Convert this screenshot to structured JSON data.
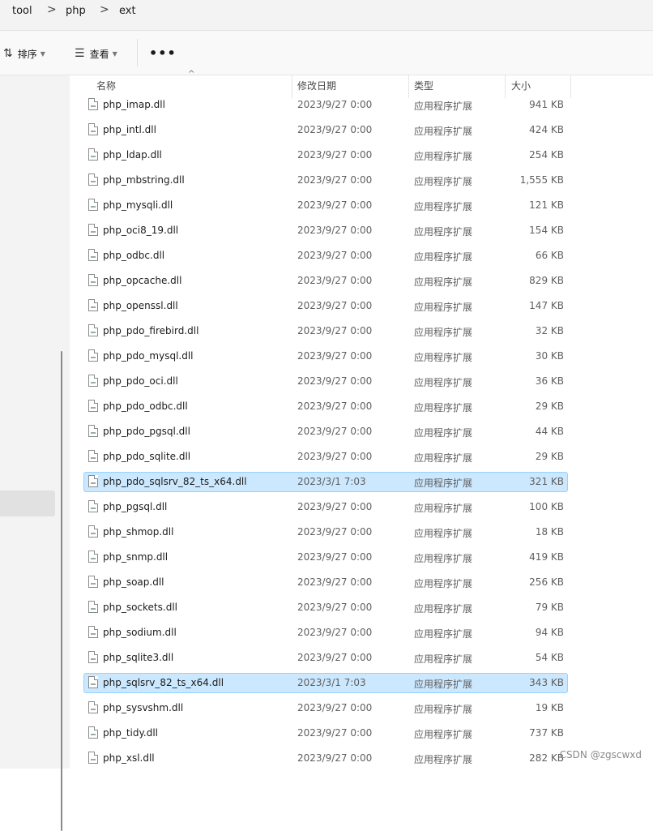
{
  "breadcrumb": {
    "items": [
      "tool",
      "php",
      "ext"
    ],
    "separator": ">"
  },
  "toolbar": {
    "sort_label": "排序",
    "view_label": "查看",
    "more_label": "•••"
  },
  "columns": {
    "name": "名称",
    "modified": "修改日期",
    "type": "类型",
    "size": "大小"
  },
  "files": [
    {
      "name": "php_imap.dll",
      "modified": "2023/9/27 0:00",
      "type": "应用程序扩展",
      "size": "941 KB",
      "selected": false
    },
    {
      "name": "php_intl.dll",
      "modified": "2023/9/27 0:00",
      "type": "应用程序扩展",
      "size": "424 KB",
      "selected": false
    },
    {
      "name": "php_ldap.dll",
      "modified": "2023/9/27 0:00",
      "type": "应用程序扩展",
      "size": "254 KB",
      "selected": false
    },
    {
      "name": "php_mbstring.dll",
      "modified": "2023/9/27 0:00",
      "type": "应用程序扩展",
      "size": "1,555 KB",
      "selected": false
    },
    {
      "name": "php_mysqli.dll",
      "modified": "2023/9/27 0:00",
      "type": "应用程序扩展",
      "size": "121 KB",
      "selected": false
    },
    {
      "name": "php_oci8_19.dll",
      "modified": "2023/9/27 0:00",
      "type": "应用程序扩展",
      "size": "154 KB",
      "selected": false
    },
    {
      "name": "php_odbc.dll",
      "modified": "2023/9/27 0:00",
      "type": "应用程序扩展",
      "size": "66 KB",
      "selected": false
    },
    {
      "name": "php_opcache.dll",
      "modified": "2023/9/27 0:00",
      "type": "应用程序扩展",
      "size": "829 KB",
      "selected": false
    },
    {
      "name": "php_openssl.dll",
      "modified": "2023/9/27 0:00",
      "type": "应用程序扩展",
      "size": "147 KB",
      "selected": false
    },
    {
      "name": "php_pdo_firebird.dll",
      "modified": "2023/9/27 0:00",
      "type": "应用程序扩展",
      "size": "32 KB",
      "selected": false
    },
    {
      "name": "php_pdo_mysql.dll",
      "modified": "2023/9/27 0:00",
      "type": "应用程序扩展",
      "size": "30 KB",
      "selected": false
    },
    {
      "name": "php_pdo_oci.dll",
      "modified": "2023/9/27 0:00",
      "type": "应用程序扩展",
      "size": "36 KB",
      "selected": false
    },
    {
      "name": "php_pdo_odbc.dll",
      "modified": "2023/9/27 0:00",
      "type": "应用程序扩展",
      "size": "29 KB",
      "selected": false
    },
    {
      "name": "php_pdo_pgsql.dll",
      "modified": "2023/9/27 0:00",
      "type": "应用程序扩展",
      "size": "44 KB",
      "selected": false
    },
    {
      "name": "php_pdo_sqlite.dll",
      "modified": "2023/9/27 0:00",
      "type": "应用程序扩展",
      "size": "29 KB",
      "selected": false
    },
    {
      "name": "php_pdo_sqlsrv_82_ts_x64.dll",
      "modified": "2023/3/1 7:03",
      "type": "应用程序扩展",
      "size": "321 KB",
      "selected": true
    },
    {
      "name": "php_pgsql.dll",
      "modified": "2023/9/27 0:00",
      "type": "应用程序扩展",
      "size": "100 KB",
      "selected": false
    },
    {
      "name": "php_shmop.dll",
      "modified": "2023/9/27 0:00",
      "type": "应用程序扩展",
      "size": "18 KB",
      "selected": false
    },
    {
      "name": "php_snmp.dll",
      "modified": "2023/9/27 0:00",
      "type": "应用程序扩展",
      "size": "419 KB",
      "selected": false
    },
    {
      "name": "php_soap.dll",
      "modified": "2023/9/27 0:00",
      "type": "应用程序扩展",
      "size": "256 KB",
      "selected": false
    },
    {
      "name": "php_sockets.dll",
      "modified": "2023/9/27 0:00",
      "type": "应用程序扩展",
      "size": "79 KB",
      "selected": false
    },
    {
      "name": "php_sodium.dll",
      "modified": "2023/9/27 0:00",
      "type": "应用程序扩展",
      "size": "94 KB",
      "selected": false
    },
    {
      "name": "php_sqlite3.dll",
      "modified": "2023/9/27 0:00",
      "type": "应用程序扩展",
      "size": "54 KB",
      "selected": false
    },
    {
      "name": "php_sqlsrv_82_ts_x64.dll",
      "modified": "2023/3/1 7:03",
      "type": "应用程序扩展",
      "size": "343 KB",
      "selected": true
    },
    {
      "name": "php_sysvshm.dll",
      "modified": "2023/9/27 0:00",
      "type": "应用程序扩展",
      "size": "19 KB",
      "selected": false
    },
    {
      "name": "php_tidy.dll",
      "modified": "2023/9/27 0:00",
      "type": "应用程序扩展",
      "size": "737 KB",
      "selected": false
    },
    {
      "name": "php_xsl.dll",
      "modified": "2023/9/27 0:00",
      "type": "应用程序扩展",
      "size": "282 KB",
      "selected": false
    }
  ],
  "watermark": "CSDN @zgscwxd",
  "colors": {
    "selection_bg": "#cce8ff",
    "selection_border": "#99d1ff"
  }
}
